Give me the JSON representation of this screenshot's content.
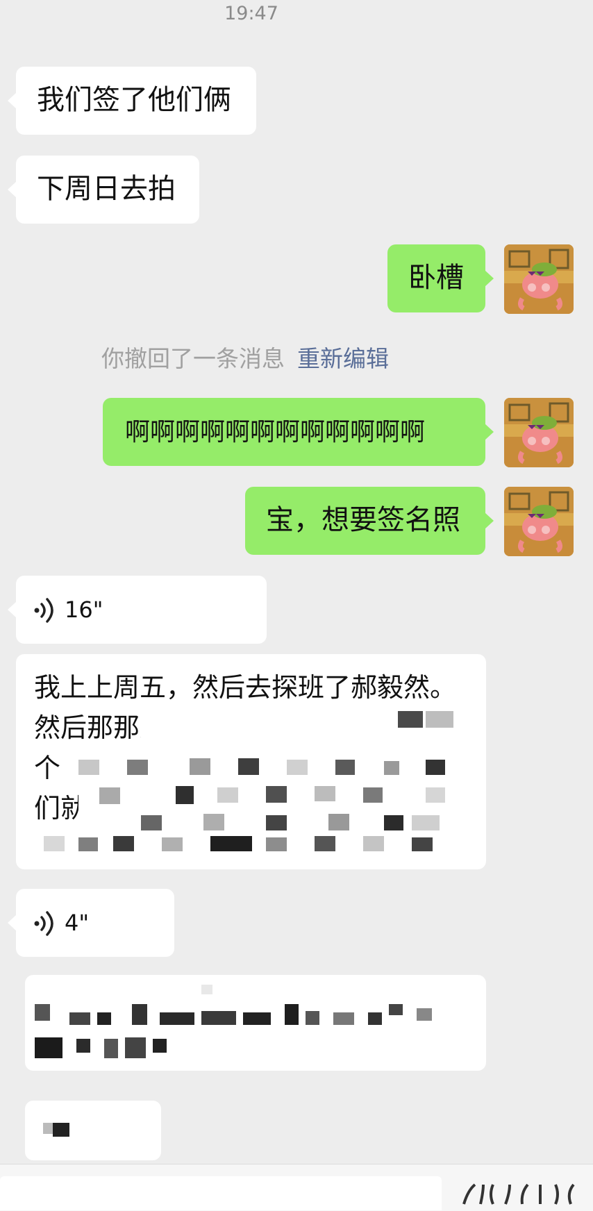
{
  "status_time": "19:47",
  "messages": {
    "m1": "我们签了他们俩",
    "m2": "下周日去拍",
    "m3": "卧槽",
    "recall": {
      "text": "你撤回了一条消息",
      "edit": "重新编辑"
    },
    "m4": "啊啊啊啊啊啊啊啊啊啊啊啊",
    "m5": "宝，想要签名照",
    "voice1": "16\"",
    "long_line1": "我上上周五，然后去探班了郝毅然。",
    "long_line2": "然后那那天好像是魔法世家",
    "long_line3": "个",
    "long_line4": "们就决",
    "voice2": "4\""
  },
  "colors": {
    "background": "#ededed",
    "left_bubble": "#ffffff",
    "right_bubble": "#95ec69",
    "recall_text": "#a0a0a0",
    "edit_link": "#5a6e98"
  },
  "icons": {
    "voice": "voice-wave-icon",
    "avatar": "cartoon-character-avatar"
  }
}
